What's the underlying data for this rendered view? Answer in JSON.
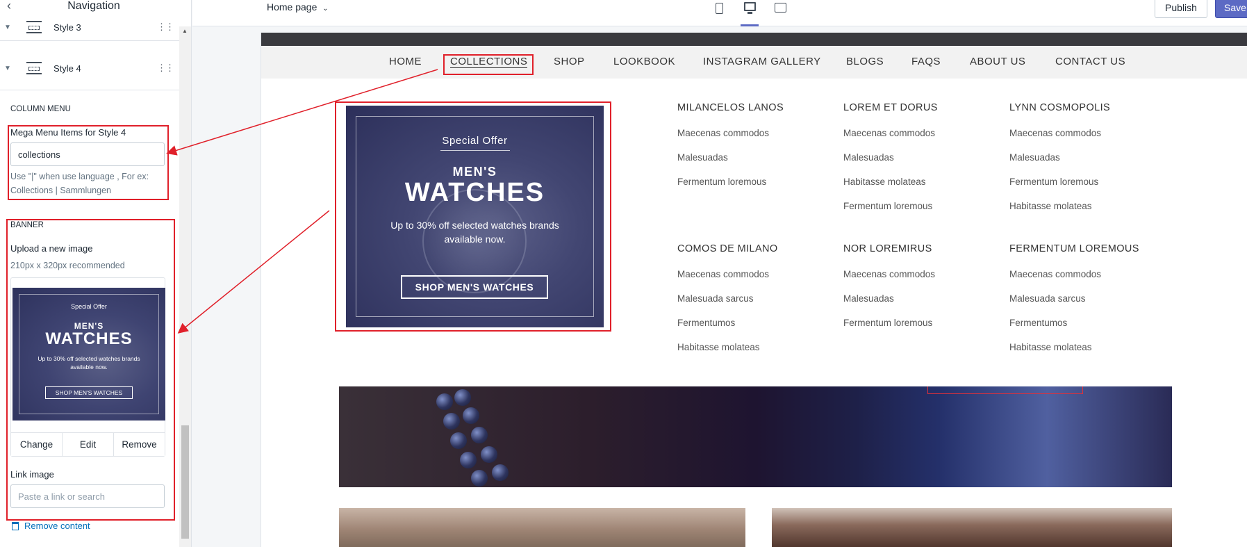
{
  "sidebar": {
    "title": "Navigation",
    "rows": [
      {
        "label": "Style 3"
      },
      {
        "label": "Style 4"
      }
    ],
    "column_menu_title": "COLUMN MENU",
    "mega_menu_label": "Mega Menu Items for Style 4",
    "mega_menu_value": "collections",
    "mega_menu_help": "Use \"|\" when use language , For ex: Collections | Sammlungen",
    "banner_title": "BANNER",
    "upload_label": "Upload a new image",
    "upload_help": "210px x 320px recommended",
    "thumb": {
      "offer": "Special Offer",
      "mens": "MEN'S",
      "watches": "WATCHES",
      "sub": "Up to 30% off selected watches brands available now.",
      "cta": "SHOP MEN'S WATCHES"
    },
    "image_actions": [
      "Change",
      "Edit",
      "Remove"
    ],
    "link_label": "Link image",
    "link_placeholder": "Paste a link or search",
    "remove_content": "Remove content"
  },
  "topbar": {
    "page_select": "Home page",
    "publish": "Publish",
    "save": "Save"
  },
  "store": {
    "nav": [
      "HOME",
      "COLLECTIONS",
      "SHOP",
      "LOOKBOOK",
      "INSTAGRAM GALLERY",
      "BLOGS",
      "FAQS",
      "ABOUT US",
      "CONTACT US"
    ],
    "active_nav": "COLLECTIONS",
    "promo": {
      "offer": "Special Offer",
      "mens": "MEN'S",
      "watches": "WATCHES",
      "sub": "Up to 30% off selected watches brands available now.",
      "cta": "SHOP MEN'S WATCHES"
    },
    "menu_columns": [
      {
        "heading": "MILANCELOS LANOS",
        "links": [
          "Maecenas commodos",
          "Malesuadas",
          "Fermentum loremous"
        ]
      },
      {
        "heading": "LOREM ET DORUS",
        "links": [
          "Maecenas commodos",
          "Malesuadas",
          "Habitasse molateas",
          "Fermentum loremous"
        ]
      },
      {
        "heading": "LYNN COSMOPOLIS",
        "links": [
          "Maecenas commodos",
          "Malesuadas",
          "Fermentum loremous",
          "Habitasse molateas"
        ]
      },
      {
        "heading": "COMOS DE MILANO",
        "links": [
          "Maecenas commodos",
          "Malesuada sarcus",
          "Fermentumos",
          "Habitasse molateas"
        ]
      },
      {
        "heading": "NOR LOREMIRUS",
        "links": [
          "Maecenas commodos",
          "Malesuadas",
          "Fermentum loremous"
        ]
      },
      {
        "heading": "FERMENTUM LOREMOUS",
        "links": [
          "Maecenas commodos",
          "Malesuada sarcus",
          "Fermentumos",
          "Habitasse molateas"
        ]
      }
    ]
  },
  "colors": {
    "accent": "#5c6ac4",
    "annotation": "#e0202a",
    "link": "#006fbb"
  }
}
